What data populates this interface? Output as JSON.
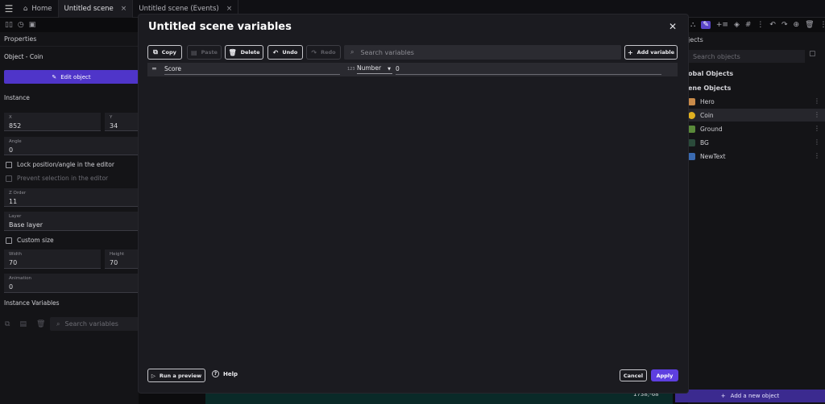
{
  "tabs": [
    {
      "label": "Home"
    },
    {
      "label": "Untitled scene"
    },
    {
      "label": "Untitled scene (Events)"
    }
  ],
  "left_panel": {
    "title": "Properties",
    "object_label": "Object  - Coin",
    "edit_button": "Edit object",
    "instance_section": "Instance",
    "fields": {
      "x_label": "X",
      "x_value": "852",
      "y_label": "Y",
      "y_value": "34",
      "angle_label": "Angle",
      "angle_value": "0",
      "zorder_label": "Z Order",
      "zorder_value": "11",
      "layer_label": "Layer",
      "layer_value": "Base layer",
      "width_label": "Width",
      "width_value": "70",
      "height_label": "Height",
      "height_value": "70",
      "animation_label": "Animation",
      "animation_value": "0"
    },
    "lock_checkbox": "Lock position/angle in the editor",
    "prevent_checkbox": "Prevent selection in the editor",
    "custom_size_checkbox": "Custom size",
    "instance_variables": "Instance Variables",
    "search_placeholder": "Search variables"
  },
  "right_panel": {
    "title": "jects",
    "search_placeholder": "Search objects",
    "global_group": "obal Objects",
    "scene_group": "ene Objects",
    "objects": [
      {
        "name": "Hero",
        "color": "#c98b4a"
      },
      {
        "name": "Coin",
        "color": "#e0b020"
      },
      {
        "name": "Ground",
        "color": "#5a8a3a"
      },
      {
        "name": "BG",
        "color": "#2a4a3a"
      },
      {
        "name": "NewText",
        "color": "#3a6ab0"
      }
    ],
    "add_button": "Add a new object"
  },
  "coords_text": "1738;-68",
  "modal": {
    "title": "Untitled scene variables",
    "toolbar": {
      "copy": "Copy",
      "paste": "Paste",
      "delete": "Delete",
      "undo": "Undo",
      "redo": "Redo",
      "search_placeholder": "Search variables",
      "add": "Add variable"
    },
    "variable": {
      "name": "Score",
      "type_icon": "123",
      "type": "Number",
      "value": "0"
    },
    "footer": {
      "run_preview": "Run a preview",
      "help": "Help",
      "cancel": "Cancel",
      "apply": "Apply"
    }
  }
}
